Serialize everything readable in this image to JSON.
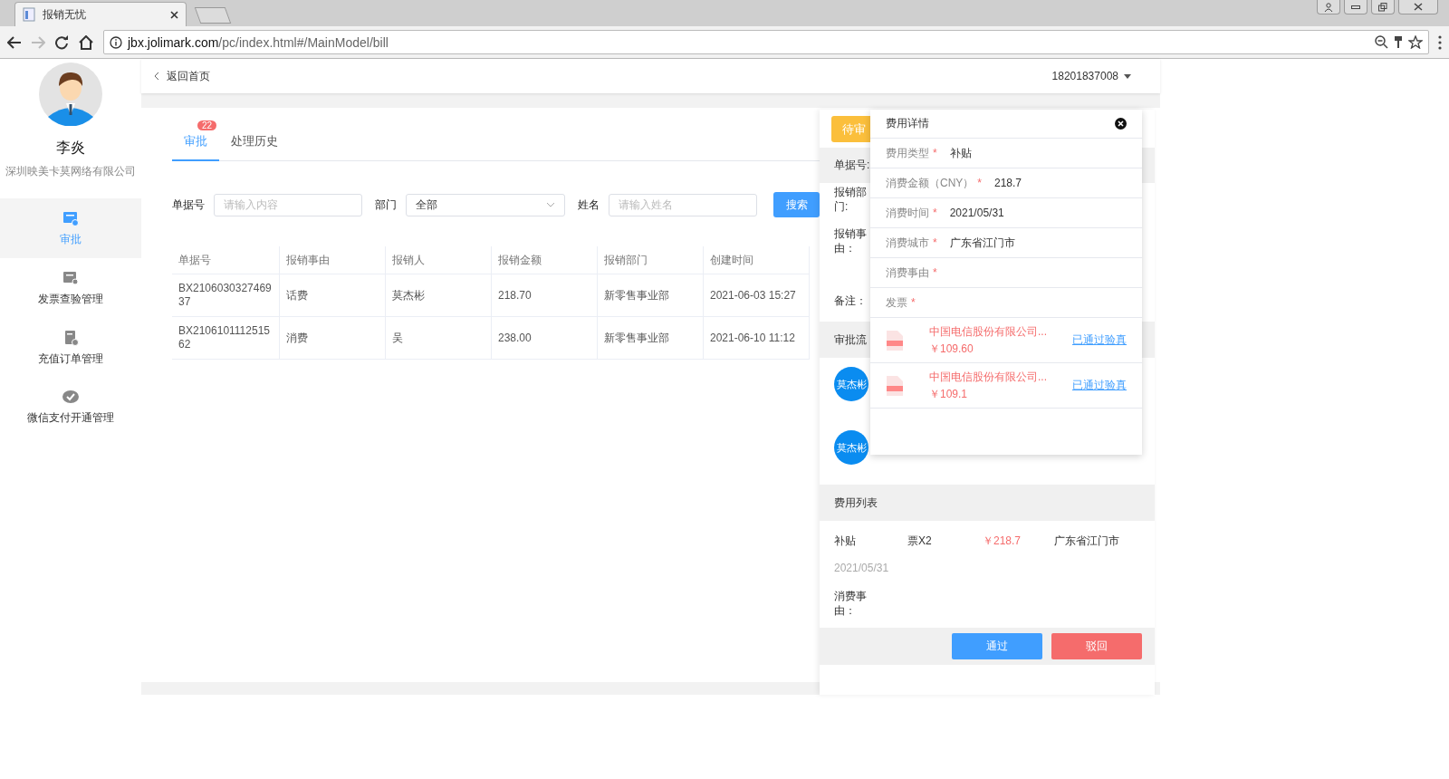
{
  "browser": {
    "tab_title": "报销无忧",
    "address": {
      "host": "jbx.jolimark.com",
      "path": "/pc/index.html#/MainModel/bill"
    }
  },
  "sidebar": {
    "user_name": "李炎",
    "company": "深圳映美卡莫网络有限公司",
    "items": [
      {
        "label": "审批",
        "selected": true
      },
      {
        "label": "发票查验管理",
        "selected": false
      },
      {
        "label": "充值订单管理",
        "selected": false
      },
      {
        "label": "微信支付开通管理",
        "selected": false
      }
    ]
  },
  "header": {
    "back": "返回首页",
    "account": "18201837008"
  },
  "tabs": [
    {
      "label": "审批",
      "selected": true,
      "badge": "22"
    },
    {
      "label": "处理历史",
      "selected": false
    }
  ],
  "filters": [
    {
      "kind": "input",
      "label": "单据号",
      "placeholder": "请输入内容"
    },
    {
      "kind": "select",
      "label": "部门",
      "value": "全部"
    },
    {
      "kind": "input",
      "label": "姓名",
      "placeholder": "请输入姓名"
    }
  ],
  "search_button": "搜索",
  "table": {
    "columns": [
      "单据号",
      "报销事由",
      "报销人",
      "报销金额",
      "报销部门",
      "创建时间"
    ],
    "rows": [
      [
        "BX210603032746937",
        "话费",
        "莫杰彬",
        "218.70",
        "新零售事业部",
        "2021-06-03 15:27"
      ],
      [
        "BX210610111251562",
        "消费",
        "吴",
        "238.00",
        "新零售事业部",
        "2021-06-10 11:12"
      ]
    ]
  },
  "drawer": {
    "status": "待审",
    "bill_label": "单据号:",
    "info": [
      "报销部门:",
      "报销事由：",
      "备注："
    ],
    "flow_title": "审批流",
    "flow": [
      {
        "avatar": "莫杰彬"
      },
      {
        "avatar": "莫杰彬"
      }
    ],
    "expense_title": "费用列表",
    "expense": {
      "type": "补贴",
      "invoices": "票X2",
      "amount": "￥218.7",
      "city": "广东省江门市",
      "date": "2021/05/31",
      "reason_label": "消费事由："
    },
    "buttons": [
      {
        "kind": "primary",
        "label": "通过"
      },
      {
        "kind": "danger",
        "label": "驳回"
      }
    ]
  },
  "popup": {
    "title": "费用详情",
    "fields": [
      {
        "label": "费用类型",
        "required_mark": "*",
        "value": "补贴"
      },
      {
        "label": "消费金额（CNY）",
        "required_mark": "*",
        "value": "218.7"
      },
      {
        "label": "消费时间",
        "required_mark": "*",
        "value": "2021/05/31"
      },
      {
        "label": "消费城市",
        "required_mark": "*",
        "value": "广东省江门市"
      },
      {
        "label": "消费事由",
        "required_mark": "*"
      },
      {
        "label": "发票",
        "required_mark": "*"
      }
    ],
    "invoices": [
      {
        "name": "中国电信股份有限公司...",
        "amount": "￥109.60",
        "status": "已通过验真"
      },
      {
        "name": "中国电信股份有限公司...",
        "amount": "￥109.1",
        "status": "已通过验真"
      }
    ]
  }
}
